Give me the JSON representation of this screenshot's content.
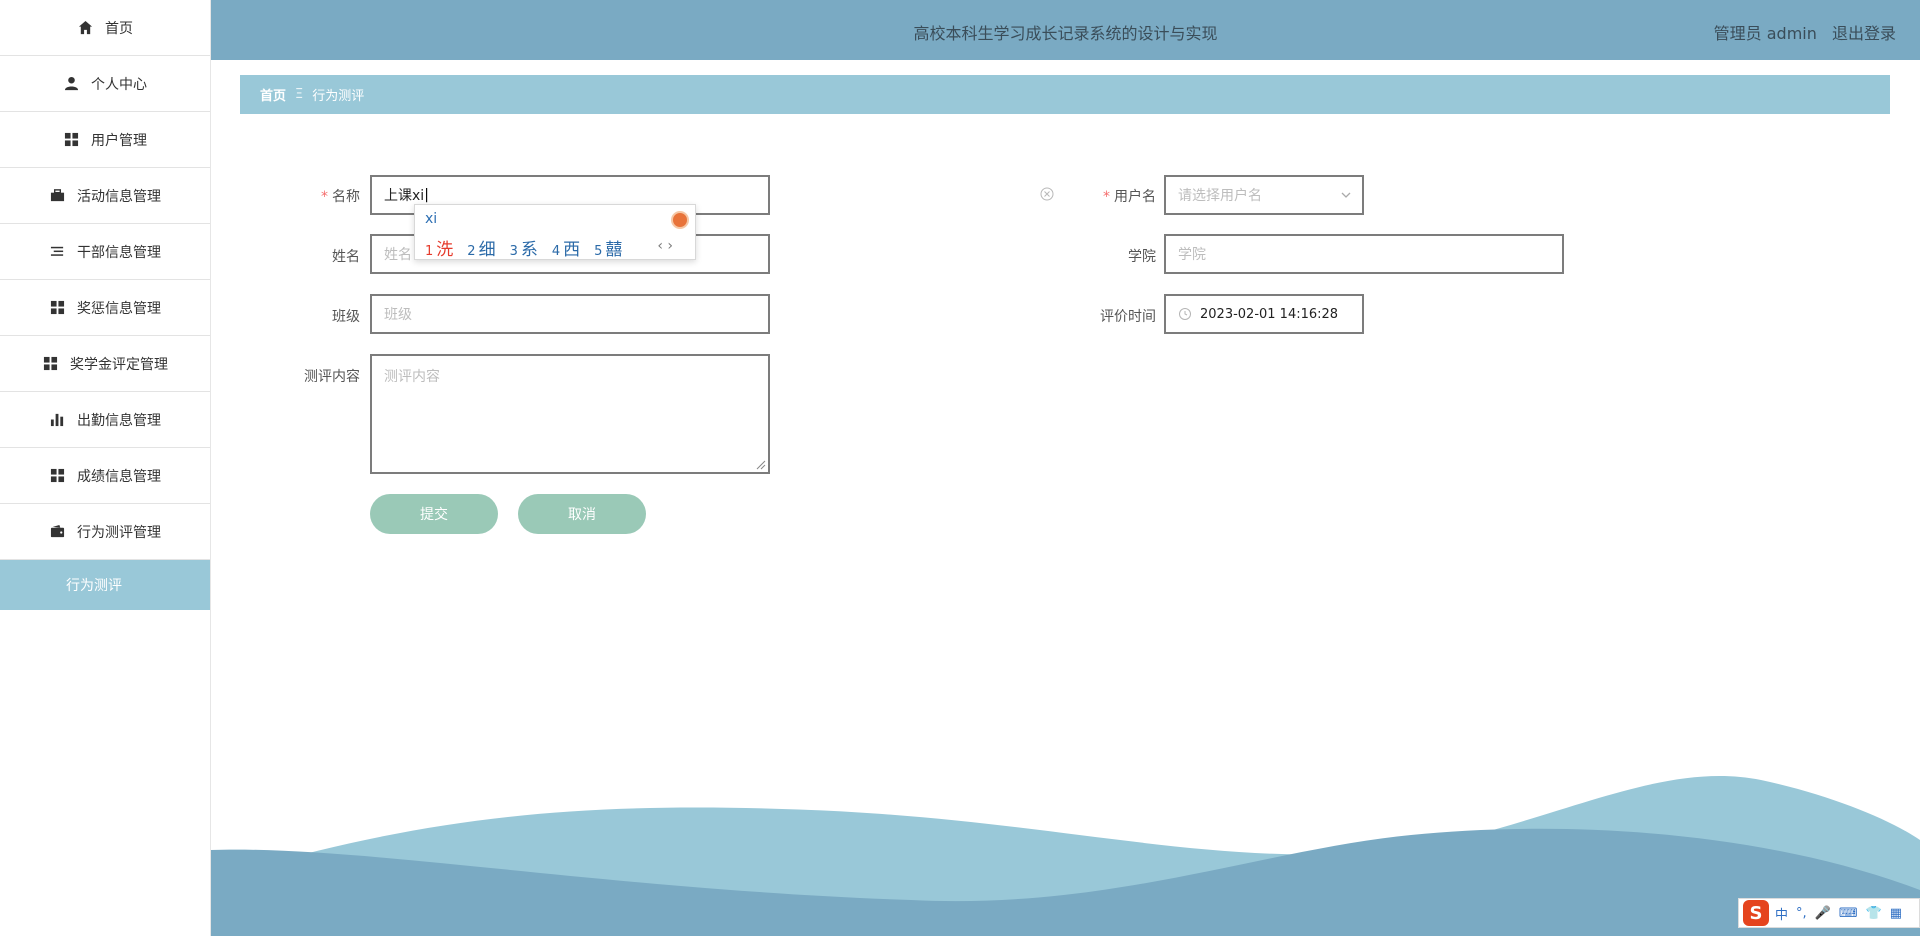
{
  "sidebar": {
    "items": [
      {
        "label": "首页",
        "icon": "home-icon"
      },
      {
        "label": "个人中心",
        "icon": "user-icon"
      },
      {
        "label": "用户管理",
        "icon": "grid-icon"
      },
      {
        "label": "活动信息管理",
        "icon": "briefcase-icon"
      },
      {
        "label": "干部信息管理",
        "icon": "list-icon"
      },
      {
        "label": "奖惩信息管理",
        "icon": "grid-icon"
      },
      {
        "label": "奖学金评定管理",
        "icon": "grid-icon"
      },
      {
        "label": "出勤信息管理",
        "icon": "bar-chart-icon"
      },
      {
        "label": "成绩信息管理",
        "icon": "grid-icon"
      },
      {
        "label": "行为测评管理",
        "icon": "wallet-icon"
      }
    ],
    "active_sub": "行为测评"
  },
  "header": {
    "title": "高校本科生学习成长记录系统的设计与实现",
    "user": "管理员 admin",
    "logout": "退出登录"
  },
  "breadcrumb": {
    "home": "首页",
    "separator": "Ξ",
    "current": "行为测评"
  },
  "form": {
    "name": {
      "label": "名称",
      "value": "上课xi",
      "required": true
    },
    "username": {
      "label": "用户名",
      "placeholder": "请选择用户名",
      "required": true
    },
    "realname": {
      "label": "姓名",
      "placeholder": "姓名"
    },
    "college": {
      "label": "学院",
      "placeholder": "学院"
    },
    "class": {
      "label": "班级",
      "placeholder": "班级"
    },
    "eval_time": {
      "label": "评价时间",
      "value": "2023-02-01 14:16:28"
    },
    "content": {
      "label": "测评内容",
      "placeholder": "测评内容"
    },
    "submit": "提交",
    "cancel": "取消"
  },
  "ime_popup": {
    "composition": "xi",
    "candidates": [
      {
        "n": "1",
        "text": "洗"
      },
      {
        "n": "2",
        "text": "细"
      },
      {
        "n": "3",
        "text": "系"
      },
      {
        "n": "4",
        "text": "西"
      },
      {
        "n": "5",
        "text": "囍"
      }
    ],
    "nav": "‹ ›"
  },
  "ime_bar": {
    "logo": "S",
    "mode": "中"
  },
  "colors": {
    "header_bg": "#7aaac3",
    "breadcrumb_bg": "#99c8d8",
    "button_bg": "#9ac9b7",
    "required": "#f56c6c"
  }
}
